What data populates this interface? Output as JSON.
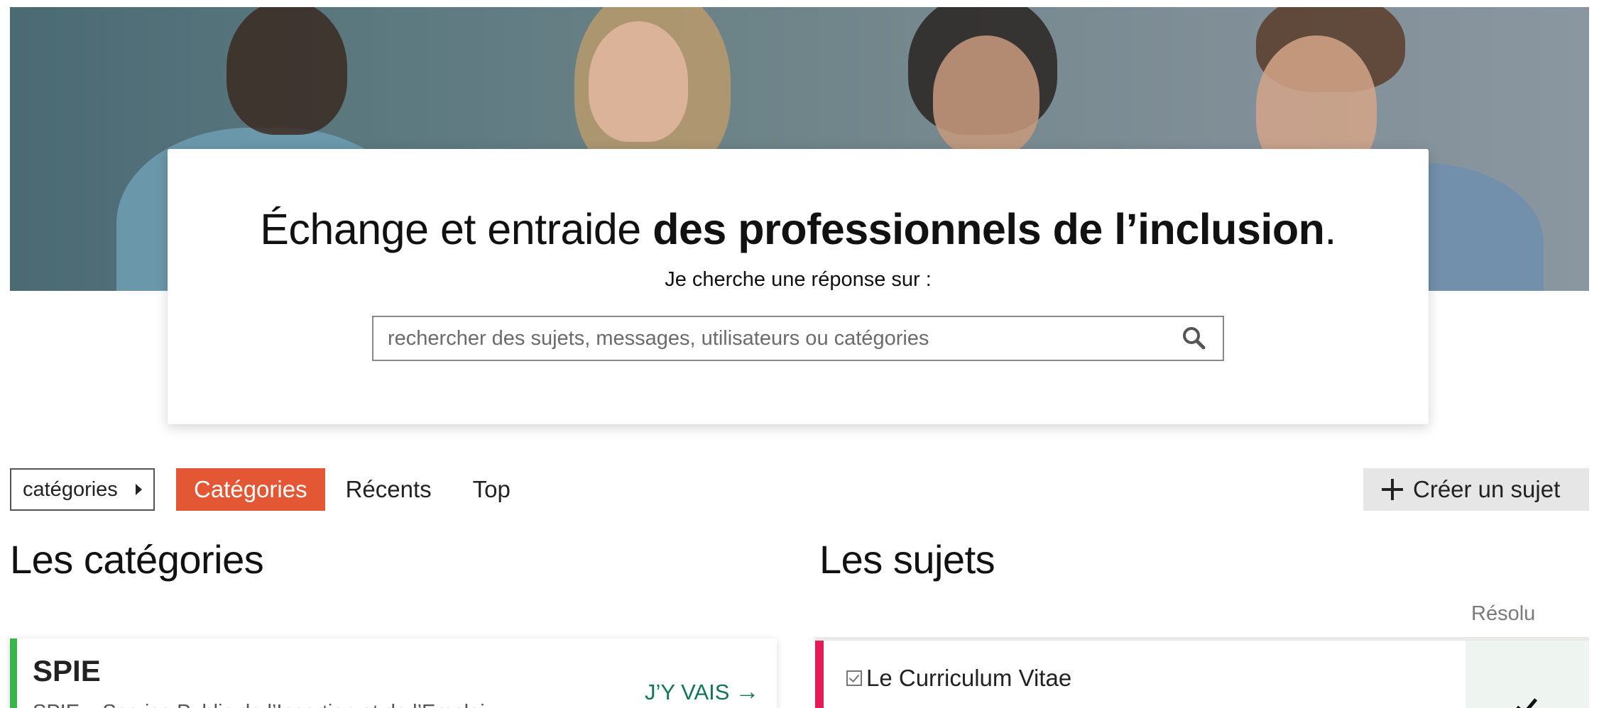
{
  "hero": {
    "headline_regular": "Échange et entraide ",
    "headline_bold": "des professionnels de l’inclusion",
    "headline_end": ".",
    "subline": "Je cherche une réponse sur :",
    "search_placeholder": "rechercher des sujets, messages, utilisateurs ou catégories"
  },
  "nav": {
    "dropdown_label": "catégories",
    "tabs": [
      {
        "label": "Catégories",
        "active": true
      },
      {
        "label": "Récents",
        "active": false
      },
      {
        "label": "Top",
        "active": false
      }
    ],
    "create_label": "Créer un sujet"
  },
  "categories": {
    "title": "Les catégories",
    "items": [
      {
        "name": "SPIE",
        "description": "SPIE – Service Public de l’Insertion et de l’Emploi",
        "link_label": "J’Y VAIS",
        "color": "#3ab54a"
      }
    ]
  },
  "topics": {
    "title": "Les sujets",
    "resolved_header": "Résolu",
    "items": [
      {
        "title": "Le Curriculum Vitae",
        "resolved": true,
        "color": "#e31b59"
      }
    ]
  },
  "colors": {
    "accent": "#e45735",
    "link": "#13765b"
  }
}
